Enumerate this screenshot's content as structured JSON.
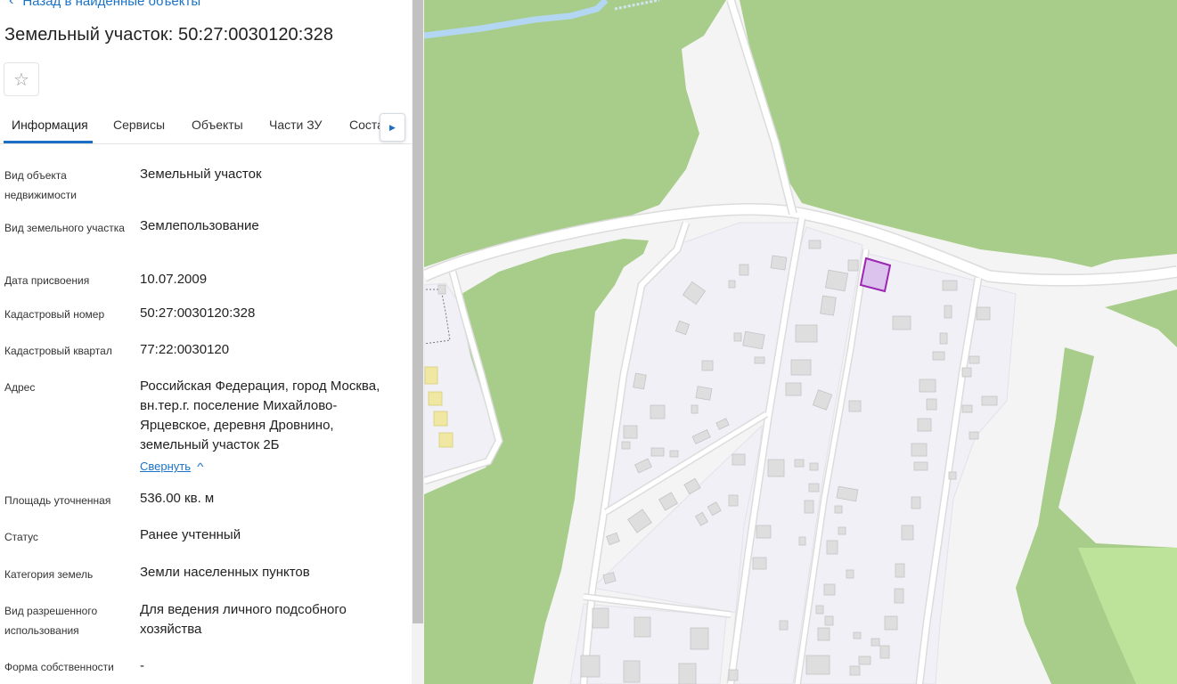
{
  "panel": {
    "back_label": "Назад в найденные объекты",
    "title": "Земельный участок: 50:27:0030120:328",
    "favorite_icon": "star-outline",
    "tabs": [
      {
        "label": "Информация"
      },
      {
        "label": "Сервисы"
      },
      {
        "label": "Объекты"
      },
      {
        "label": "Части ЗУ"
      },
      {
        "label": "Соста"
      }
    ],
    "tabs_next_icon": "caret-right",
    "info": {
      "object_type": {
        "label": "Вид объекта недвижимости",
        "value": "Земельный участок"
      },
      "land_type": {
        "label": "Вид земельного участка",
        "value": "Землепользование"
      },
      "assign_date": {
        "label": "Дата присвоения",
        "value": "10.07.2009"
      },
      "cadastral_number": {
        "label": "Кадастровый номер",
        "value": "50:27:0030120:328"
      },
      "cadastral_quarter": {
        "label": "Кадастровый квартал",
        "value": "77:22:0030120"
      },
      "address": {
        "label": "Адрес",
        "value": "Российская Федерация, город Москва, вн.тер.г. поселение Михайлово-Ярцевское, деревня Дровнино, земельный участок 2Б",
        "collapse_label": "Свернуть"
      },
      "area": {
        "label": "Площадь уточненная",
        "value": "536.00 кв. м"
      },
      "status": {
        "label": "Статус",
        "value": "Ранее учтенный"
      },
      "land_category": {
        "label": "Категория земель",
        "value": "Земли населенных пунктов"
      },
      "permitted_use": {
        "label": "Вид разрешенного использования",
        "value": "Для ведения личного подсобного хозяйства"
      },
      "ownership": {
        "label": "Форма собственности",
        "value": "-"
      }
    }
  },
  "colors": {
    "accent": "#1a73c8",
    "forest": "#a8cd8a",
    "meadow": "#bde39a",
    "residential": "#f1f1f6",
    "road": "#ffffff",
    "river": "#b3d7f2",
    "highlight_fill": "#dcc3ee",
    "highlight_stroke": "#9c27b0"
  }
}
